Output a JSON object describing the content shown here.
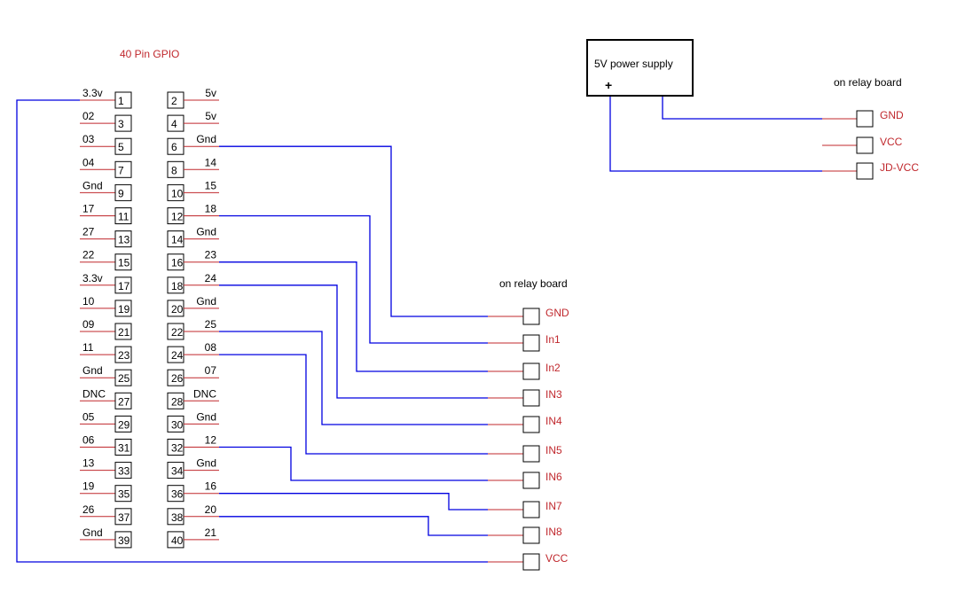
{
  "header": {
    "title": "40 Pin GPIO"
  },
  "gpio": {
    "left": [
      {
        "pin": "1",
        "label": "3.3v"
      },
      {
        "pin": "3",
        "label": "02"
      },
      {
        "pin": "5",
        "label": "03"
      },
      {
        "pin": "7",
        "label": "04"
      },
      {
        "pin": "9",
        "label": "Gnd"
      },
      {
        "pin": "11",
        "label": "17"
      },
      {
        "pin": "13",
        "label": "27"
      },
      {
        "pin": "15",
        "label": "22"
      },
      {
        "pin": "17",
        "label": "3.3v"
      },
      {
        "pin": "19",
        "label": "10"
      },
      {
        "pin": "21",
        "label": "09"
      },
      {
        "pin": "23",
        "label": "11"
      },
      {
        "pin": "25",
        "label": "Gnd"
      },
      {
        "pin": "27",
        "label": "DNC"
      },
      {
        "pin": "29",
        "label": "05"
      },
      {
        "pin": "31",
        "label": "06"
      },
      {
        "pin": "33",
        "label": "13"
      },
      {
        "pin": "35",
        "label": "19"
      },
      {
        "pin": "37",
        "label": "26"
      },
      {
        "pin": "39",
        "label": "Gnd"
      }
    ],
    "right": [
      {
        "pin": "2",
        "label": "5v"
      },
      {
        "pin": "4",
        "label": "5v"
      },
      {
        "pin": "6",
        "label": "Gnd"
      },
      {
        "pin": "8",
        "label": "14"
      },
      {
        "pin": "10",
        "label": "15"
      },
      {
        "pin": "12",
        "label": "18"
      },
      {
        "pin": "14",
        "label": "Gnd"
      },
      {
        "pin": "16",
        "label": "23"
      },
      {
        "pin": "18",
        "label": "24"
      },
      {
        "pin": "20",
        "label": "Gnd"
      },
      {
        "pin": "22",
        "label": "25"
      },
      {
        "pin": "24",
        "label": "08"
      },
      {
        "pin": "26",
        "label": "07"
      },
      {
        "pin": "28",
        "label": "DNC"
      },
      {
        "pin": "30",
        "label": "Gnd"
      },
      {
        "pin": "32",
        "label": "12"
      },
      {
        "pin": "34",
        "label": "Gnd"
      },
      {
        "pin": "36",
        "label": "16"
      },
      {
        "pin": "38",
        "label": "20"
      },
      {
        "pin": "40",
        "label": "21"
      }
    ]
  },
  "relay_main": {
    "title": "on relay board",
    "terminals": [
      "GND",
      "In1",
      "In2",
      "IN3",
      "IN4",
      "IN5",
      "IN6",
      "IN7",
      "IN8",
      "VCC"
    ]
  },
  "power": {
    "label": "5V power supply",
    "plus": "+",
    "relay_title": "on relay board",
    "terminals": [
      "GND",
      "VCC",
      "JD-VCC"
    ]
  },
  "connections": [
    {
      "from": "pin 6 (Gnd)",
      "to": "GND"
    },
    {
      "from": "pin 12 (18)",
      "to": "In1"
    },
    {
      "from": "pin 16 (23)",
      "to": "In2"
    },
    {
      "from": "pin 18 (24)",
      "to": "IN3"
    },
    {
      "from": "pin 22 (25)",
      "to": "IN4"
    },
    {
      "from": "pin 24 (08)",
      "to": "IN5"
    },
    {
      "from": "pin 32 (12)",
      "to": "IN6"
    },
    {
      "from": "pin 36 (16)",
      "to": "IN7"
    },
    {
      "from": "pin 38 (20)",
      "to": "IN8"
    },
    {
      "from": "pin 1 (3.3v)",
      "to": "VCC"
    },
    {
      "from": "5V supply -",
      "to": "GND (JD side)"
    },
    {
      "from": "5V supply +",
      "to": "JD-VCC"
    }
  ],
  "colors": {
    "wire": "#0000e0",
    "lead": "#c0282d",
    "label_red": "#c0282d",
    "box": "#000000"
  }
}
